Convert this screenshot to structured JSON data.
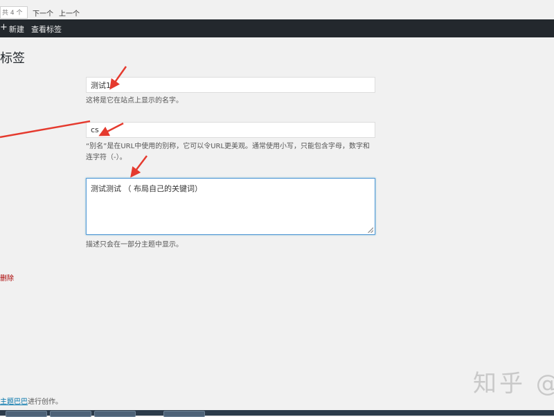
{
  "top_nav": {
    "count_text": "共 4 个",
    "next_label": "下一个",
    "prev_label": "上一个"
  },
  "admin_bar": {
    "plus_glyph": "+",
    "new_label": "新建",
    "view_tag_label": "查看标签"
  },
  "page": {
    "title": "标签"
  },
  "form": {
    "name_value": "测试1",
    "name_help": "这将是它在站点上显示的名字。",
    "slug_value": "cs",
    "slug_help": "“别名”是在URL中使用的别称，它可以令URL更美观。通常使用小写，只能包含字母，数字和连字符（-）。",
    "description_value": "测试测试 （ 布局自己的关键词）",
    "description_help": "描述只会在一部分主题中显示。",
    "delete_label": "删除"
  },
  "footer": {
    "link_text": "主题巴巴",
    "suffix_text": "进行创作。"
  },
  "watermark": {
    "text": "知乎 @"
  },
  "colors": {
    "admin_bar": "#23282d",
    "arrow": "#e53a2e",
    "focus_border": "#5b9dd9",
    "link": "#0073aa",
    "delete": "#a00"
  }
}
